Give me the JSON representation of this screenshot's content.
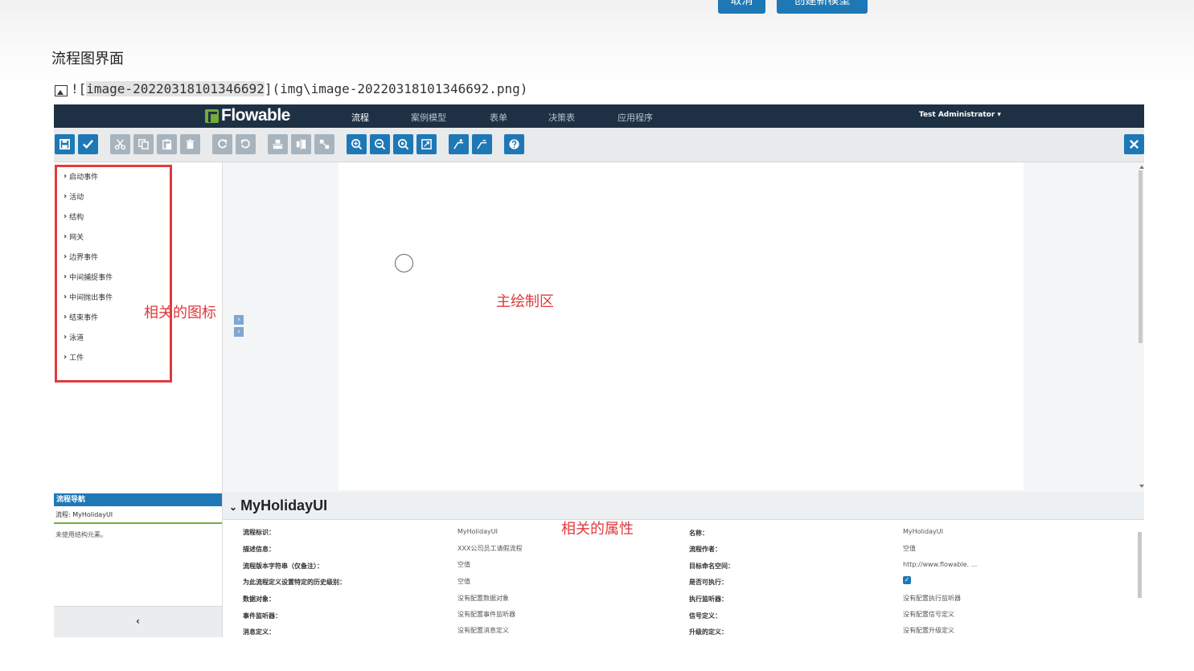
{
  "top_buttons": {
    "cancel": "取消",
    "create": "创建新模型"
  },
  "heading": "流程图界面",
  "markdown_image": {
    "prefix": "![",
    "alt": "image-20220318101346692",
    "suffix": "](img\\image-20220318101346692.png)"
  },
  "navbar": {
    "logo": "Flowable",
    "items": [
      "流程",
      "案例模型",
      "表单",
      "决策表",
      "应用程序"
    ],
    "active_item": "流程",
    "user": "Test Administrator ▾"
  },
  "toolbar": {
    "icons": [
      "save-icon",
      "validate-icon",
      "cut-icon",
      "copy-icon",
      "paste-icon",
      "delete-icon",
      "redo-icon",
      "undo-icon",
      "align-vertical-icon",
      "align-horizontal-icon",
      "same-size-icon",
      "zoom-in-icon",
      "zoom-out-icon",
      "zoom-actual-icon",
      "zoom-fit-icon",
      "bendpoint-add-icon",
      "bendpoint-remove-icon",
      "help-icon",
      "close-icon"
    ],
    "accent_color": "#1f78b6"
  },
  "palette": {
    "items": [
      "启动事件",
      "活动",
      "结构",
      "网关",
      "边界事件",
      "中间捕捉事件",
      "中间抛出事件",
      "结束事件",
      "泳道",
      "工件"
    ]
  },
  "annotations": {
    "icons": "相关的图标",
    "canvas": "主绘制区",
    "properties": "相关的属性"
  },
  "navigator": {
    "header": "流程导航",
    "process": "流程: MyHolidayUI",
    "note": "未使用结构元素。",
    "collapse": "‹"
  },
  "properties": {
    "title": "MyHolidayUI",
    "left": [
      {
        "label": "流程标识：",
        "value": "MyHolidayUI"
      },
      {
        "label": "描述信息：",
        "value": "XXX公司员工请假流程"
      },
      {
        "label": "流程版本字符串（仅备注）：",
        "value": "空值"
      },
      {
        "label": "为此流程定义设置特定的历史级别：",
        "value": "空值"
      },
      {
        "label": "数据对象：",
        "value": "没有配置数据对象"
      },
      {
        "label": "事件监听器：",
        "value": "没有配置事件监听器"
      },
      {
        "label": "消息定义：",
        "value": "没有配置消息定义"
      }
    ],
    "right": [
      {
        "label": "名称：",
        "value": "MyHolidayUI"
      },
      {
        "label": "流程作者：",
        "value": "空值"
      },
      {
        "label": "目标命名空间：",
        "value": "http://www.flowable. ..."
      },
      {
        "label": "是否可执行：",
        "value": ""
      },
      {
        "label": "执行监听器：",
        "value": "没有配置执行监听器"
      },
      {
        "label": "信号定义：",
        "value": "没有配置信号定义"
      },
      {
        "label": "升级的定义：",
        "value": "没有配置升级定义"
      }
    ],
    "is_executable": true
  }
}
